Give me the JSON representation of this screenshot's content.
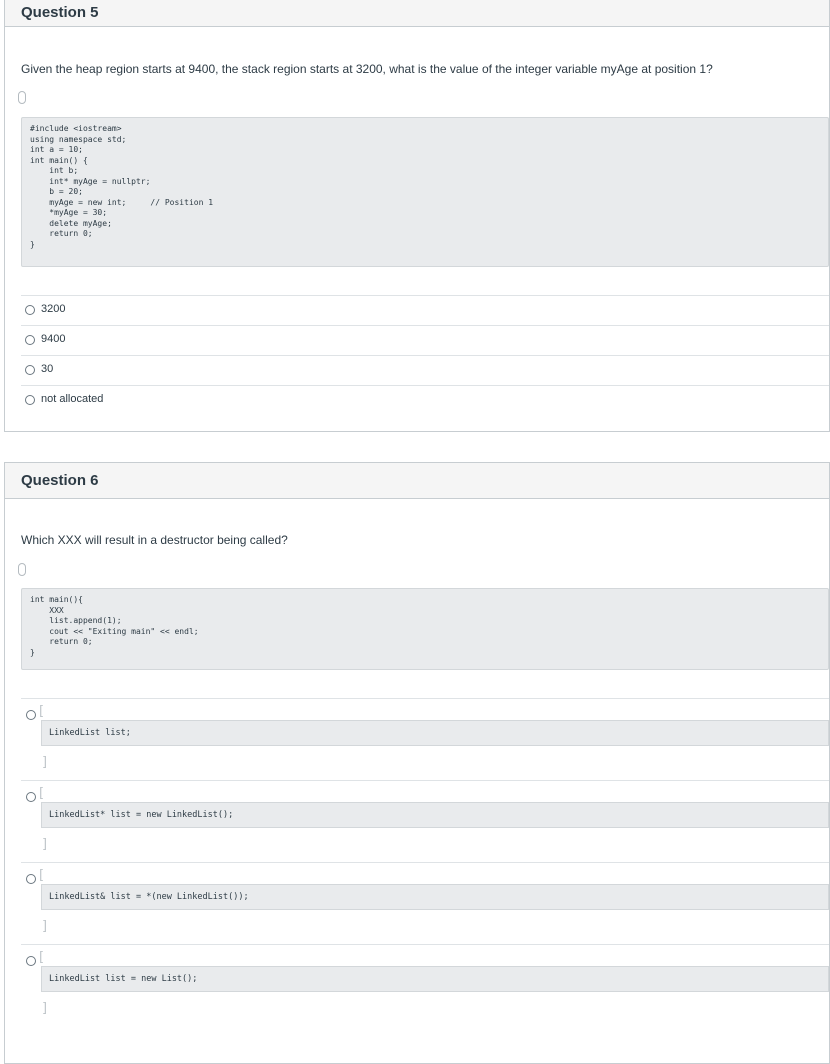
{
  "q5": {
    "title": "Question 5",
    "prompt": "Given the heap region starts at 9400, the stack region starts at 3200, what is the value of the integer variable myAge at position 1?",
    "code": "#include <iostream>\nusing namespace std;\nint a = 10;\nint main() {\n    int b;\n    int* myAge = nullptr;\n    b = 20;\n    myAge = new int;     // Position 1\n    *myAge = 30;\n    delete myAge;\n    return 0;\n}",
    "answers": [
      "3200",
      "9400",
      "30",
      "not allocated"
    ]
  },
  "q6": {
    "title": "Question 6",
    "prompt": "Which XXX will result in a destructor being called?",
    "code": "int main(){\n    XXX\n    list.append(1);\n    cout << \"Exiting main\" << endl;\n    return 0;\n}",
    "answers": [
      "LinkedList list;",
      "LinkedList* list = new LinkedList();",
      "LinkedList& list = *(new LinkedList());",
      "LinkedList list = new List();"
    ]
  }
}
